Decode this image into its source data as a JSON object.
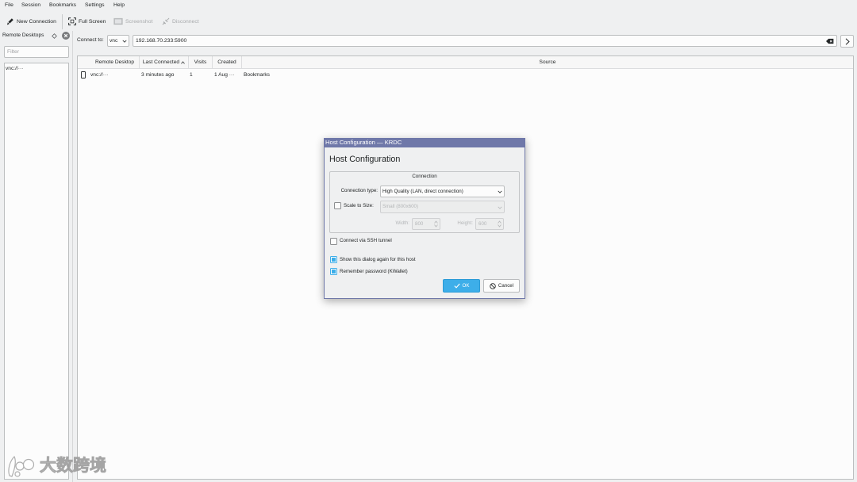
{
  "menubar": {
    "items": [
      "File",
      "Session",
      "Bookmarks",
      "Settings",
      "Help"
    ]
  },
  "toolbar": {
    "new_connection": "New Connection",
    "full_screen": "Full Screen",
    "screenshot": "Screenshot",
    "disconnect": "Disconnect"
  },
  "sidebar": {
    "title": "Remote Desktops",
    "filter_placeholder": "Filter",
    "items": [
      "vnc://···"
    ]
  },
  "connect_bar": {
    "label": "Connect to:",
    "protocol": "vnc",
    "address": "192.168.70.233:5900"
  },
  "table": {
    "columns": [
      "Remote Desktop",
      "Last Connected",
      "Visits",
      "Created",
      "Source"
    ],
    "rows": [
      {
        "remote_desktop": "vnc://···",
        "last_connected": "3 minutes ago",
        "visits": "1",
        "created": "1 Aug ···",
        "source": "Bookmarks"
      }
    ]
  },
  "dialog": {
    "window_title": "Host Configuration — KRDC",
    "heading": "Host Configuration",
    "group_title": "Connection",
    "connection_type_label": "Connection type:",
    "connection_type_value": "High Quality (LAN, direct connection)",
    "scale_label": "Scale to Size:",
    "scale_checked": false,
    "scale_value": "Small (800x600)",
    "width_label": "Width:",
    "width_value": "800",
    "height_label": "Height:",
    "height_value": "600",
    "ssh_label": "Connect via SSH tunnel",
    "ssh_checked": false,
    "show_again_label": "Show this dialog again for this host",
    "show_again_checked": true,
    "remember_label": "Remember password (KWallet)",
    "remember_checked": true,
    "ok_label": "OK",
    "cancel_label": "Cancel"
  },
  "icons": {
    "new_connection": "pen-icon",
    "full_screen": "fullscreen-icon",
    "screenshot": "screenshot-icon",
    "disconnect": "plug-icon",
    "sidebar_pin": "pin-icon",
    "sidebar_close": "close-icon",
    "clear_address": "clear-icon",
    "go": "chevron-right-icon",
    "sort_indicator": "chevron-up-icon",
    "row": "display-icon",
    "ok": "check-icon",
    "cancel": "cancel-icon"
  },
  "colors": {
    "window_bg": "#eff0f1",
    "accent": "#3daee9",
    "dialog_titlebar": "#6f78a9",
    "disabled_text": "#a8aaac"
  },
  "watermark": {
    "text": "大数跨境"
  }
}
